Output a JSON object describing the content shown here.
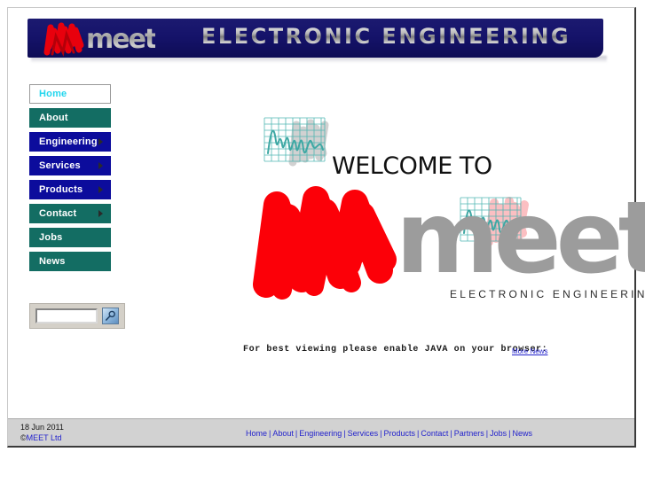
{
  "header": {
    "logo_word": "meet",
    "title": "ELECTRONIC ENGINEERING",
    "background_color": "#15136a",
    "scribble_color": "#e8000d",
    "wordmark_color": "#a8a8a8"
  },
  "sidebar": {
    "items": [
      {
        "label": "Home",
        "style": "current",
        "has_arrow": false
      },
      {
        "label": "About",
        "style": "teal",
        "has_arrow": false
      },
      {
        "label": "Engineering",
        "style": "navy",
        "has_arrow": true
      },
      {
        "label": "Services",
        "style": "navy",
        "has_arrow": true
      },
      {
        "label": "Products",
        "style": "navy",
        "has_arrow": true
      },
      {
        "label": "Contact",
        "style": "teal",
        "has_arrow": true
      },
      {
        "label": "Jobs",
        "style": "teal",
        "has_arrow": false
      },
      {
        "label": "News",
        "style": "teal",
        "has_arrow": false
      }
    ],
    "colors": {
      "teal": "#136d63",
      "navy": "#0c0c9c",
      "current_text": "#22d6ee"
    }
  },
  "search": {
    "value": "",
    "placeholder": "",
    "button_icon": "search-icon"
  },
  "main": {
    "welcome_text": "WELCOME TO",
    "logo_word": "meet",
    "logo_subtitle": "ELECTRONIC ENGINEERING",
    "logo_red": "#fc0008",
    "logo_gray": "#9c9c9c",
    "wave_color": "#49b5b0",
    "java_notice": "For best viewing please enable JAVA on your browser:",
    "more_news_label": "More News"
  },
  "footer": {
    "date": "18 Jun 2011",
    "copyright_symbol": "©",
    "copyright_text": "MEET Ltd",
    "links": [
      "Home",
      "About",
      "Engineering",
      "Services",
      "Products",
      "Contact",
      "Partners",
      "Jobs",
      "News"
    ],
    "separator": "|",
    "link_color": "#2222cc",
    "background_color": "#d2d2d2"
  }
}
